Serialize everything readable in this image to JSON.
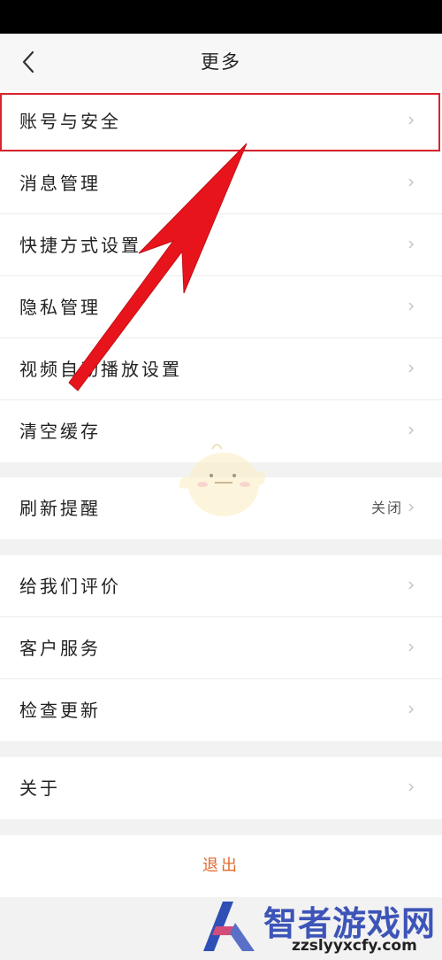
{
  "header": {
    "title": "更多",
    "back_icon": "chevron-left-icon"
  },
  "group1": [
    {
      "label": "账号与安全"
    },
    {
      "label": "消息管理"
    },
    {
      "label": "快捷方式设置"
    },
    {
      "label": "隐私管理"
    },
    {
      "label": "视频自动播放设置"
    },
    {
      "label": "清空缓存"
    }
  ],
  "group2": [
    {
      "label": "刷新提醒",
      "value": "关闭"
    }
  ],
  "group3": [
    {
      "label": "给我们评价"
    },
    {
      "label": "客户服务"
    },
    {
      "label": "检查更新"
    }
  ],
  "group4": [
    {
      "label": "关于"
    }
  ],
  "logout": {
    "label": "退出"
  },
  "annotation": {
    "highlight_color": "#d8252e",
    "arrow_color": "#e8141c"
  },
  "watermark": {
    "brand": "智者游戏网",
    "url": "zzslyyxcfy.com"
  },
  "colors": {
    "accent": "#e36a2c",
    "background": "#f2f2f2"
  }
}
